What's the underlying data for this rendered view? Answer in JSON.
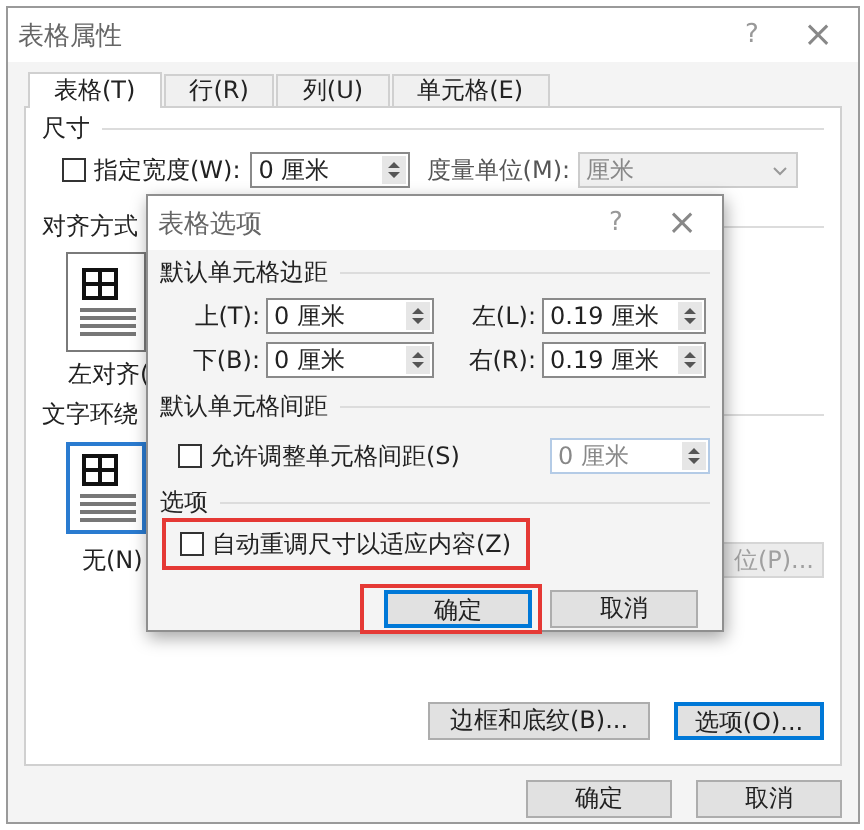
{
  "window": {
    "title": "表格属性",
    "help": "?",
    "close": "×"
  },
  "tabs": [
    {
      "label": "表格(T)",
      "selected": true
    },
    {
      "label": "行(R)",
      "selected": false
    },
    {
      "label": "列(U)",
      "selected": false
    },
    {
      "label": "单元格(E)",
      "selected": false
    }
  ],
  "size": {
    "heading": "尺寸",
    "width_check": {
      "label": "指定宽度(W):",
      "checked": false
    },
    "width_value": "0 厘米",
    "unit_label": "度量单位(M):",
    "unit": {
      "value": "厘米",
      "disabled": true
    }
  },
  "alignment": {
    "heading": "对齐方式",
    "options": [
      {
        "label": "左对齐(",
        "selected": false
      }
    ]
  },
  "wrapping": {
    "heading": "文字环绕",
    "options": [
      {
        "label": "无(N)",
        "selected": true
      }
    ],
    "position_button": {
      "label": "位(P)...",
      "disabled": true
    }
  },
  "buttons": [
    {
      "label": "边框和底纹(B)...",
      "focused": false
    },
    {
      "label": "选项(O)...",
      "focused": true
    }
  ],
  "footer_buttons": [
    "确定",
    "取消"
  ],
  "options_dialog": {
    "title": "表格选项",
    "help": "?",
    "close": "×",
    "margins_heading": "默认单元格边距",
    "margins": [
      {
        "label": "上(T):",
        "value": "0 厘米"
      },
      {
        "label": "左(L):",
        "value": "0.19 厘米"
      },
      {
        "label": "下(B):",
        "value": "0 厘米"
      },
      {
        "label": "右(R):",
        "value": "0.19 厘米"
      }
    ],
    "spacing_heading": "默认单元格间距",
    "spacing_check": {
      "label": "允许调整单元格间距(S)",
      "checked": false
    },
    "spacing_value": {
      "value": "0 厘米",
      "disabled": true
    },
    "options_heading": "选项",
    "autofit": {
      "label": "自动重调尺寸以适应内容(Z)",
      "checked": false,
      "highlighted": true
    },
    "buttons": [
      {
        "label": "确定",
        "default": true,
        "highlighted": true
      },
      {
        "label": "取消",
        "default": false,
        "highlighted": false
      }
    ]
  }
}
